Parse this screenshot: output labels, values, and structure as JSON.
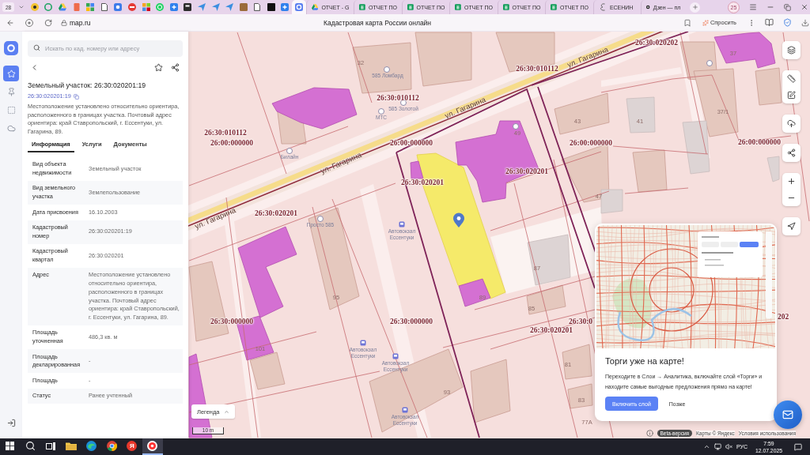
{
  "browser": {
    "tab_count": "28",
    "pinned_tabs": [
      {
        "selected": false
      },
      {
        "selected": false
      },
      {
        "selected": false
      },
      {
        "selected": false
      },
      {
        "selected": false
      },
      {
        "selected": false
      },
      {
        "selected": false
      },
      {
        "selected": false
      },
      {
        "selected": false
      },
      {
        "selected": false
      },
      {
        "selected": false
      },
      {
        "selected": false
      },
      {
        "selected": false
      },
      {
        "selected": false
      },
      {
        "selected": false
      },
      {
        "selected": false
      },
      {
        "selected": false
      },
      {
        "selected": false
      },
      {
        "selected": false
      },
      {
        "selected": true
      }
    ],
    "tabs": [
      {
        "kind": "drive",
        "title": "ОТЧЕТ - G",
        "selected": false
      },
      {
        "kind": "sheet",
        "title": "ОТЧЕТ ПО",
        "selected": false
      },
      {
        "kind": "sheet",
        "title": "ОТЧЕТ ПО",
        "selected": false
      },
      {
        "kind": "sheet",
        "title": "ОТЧЕТ ПО",
        "selected": false
      },
      {
        "kind": "sheet",
        "title": "ОТЧЕТ ПО",
        "selected": false
      },
      {
        "kind": "sheet",
        "title": "ОТЧЕТ ПО",
        "selected": false
      },
      {
        "kind": "letter",
        "title": "ЕСЕНИН",
        "selected": false
      },
      {
        "kind": "dzen",
        "title": "Дзен — пл",
        "selected": false
      }
    ],
    "profile": "25",
    "url": "map.ru",
    "page_title": "Кадастровая карта России онлайн",
    "ask_button": "Спросить"
  },
  "rail": [
    {
      "selected": true
    },
    {
      "selected": false
    },
    {
      "selected": false
    },
    {
      "selected": false
    }
  ],
  "panel": {
    "search": {
      "placeholder": "Искать по кад. номеру или адресу"
    },
    "title": "Земельный участок: 26:30:020201:19",
    "number_link": "26:30:020201:19",
    "description": "Местоположение установлено относительно ориентира, расположенного в границах участка. Почтовый адрес ориентира: край Ставропольский, г. Ессентуки, ул. Гагарина, 89.",
    "tabs": [
      {
        "label": "Информация",
        "selected": true
      },
      {
        "label": "Услуги",
        "selected": false
      },
      {
        "label": "Документы",
        "selected": false
      }
    ],
    "properties": [
      {
        "label": "Вид объекта недвижимости",
        "value": "Земельный участок"
      },
      {
        "label": "Вид земельного участка",
        "value": "Землепользование"
      },
      {
        "label": "Дата присвоения",
        "value": "16.10.2003"
      },
      {
        "label": "Кадастровый номер",
        "value": "26:30:020201:19"
      },
      {
        "label": "Кадастровый квартал",
        "value": "26:30:020201"
      },
      {
        "label": "Адрес",
        "value": "Местоположение установлено относительно ориентира, расположенного в границах участка. Почтовый адрес ориентира: край Ставропольский, г. Ессентуки, ул. Гагарина, 89."
      },
      {
        "label": "Площадь уточненная",
        "value": "486,3 кв. м"
      },
      {
        "label": "Площадь декларированная",
        "value": "-"
      },
      {
        "label": "Площадь",
        "value": "-"
      },
      {
        "label": "Статус",
        "value": "Ранее учтенный"
      }
    ]
  },
  "map": {
    "labels": [
      {
        "kind": "cadastral",
        "text": "26:30:020202"
      },
      {
        "kind": "street",
        "text": "ул. Гагарина"
      },
      {
        "kind": "house",
        "text": "37"
      },
      {
        "kind": "house",
        "text": "32"
      },
      {
        "kind": "cadastral",
        "text": "26:30:010112"
      },
      {
        "kind": "place",
        "text": "585 Ломбард"
      },
      {
        "kind": "cadastral",
        "text": "26:30:010112"
      },
      {
        "kind": "place",
        "text": "585 Золотой"
      },
      {
        "kind": "street",
        "text": "ул. Гагарина"
      },
      {
        "kind": "house",
        "text": "37/1"
      },
      {
        "kind": "place",
        "text": "МТС"
      },
      {
        "kind": "house",
        "text": "43"
      },
      {
        "kind": "house",
        "text": "41"
      },
      {
        "kind": "cadastral",
        "text": "26:30:010112"
      },
      {
        "kind": "house",
        "text": "49"
      },
      {
        "kind": "cadastral",
        "text": "26:00:000000"
      },
      {
        "kind": "cadastral",
        "text": "26:00:000000"
      },
      {
        "kind": "cadastral",
        "text": "26:00:000000"
      },
      {
        "kind": "cadastral",
        "text": "26:00:000000"
      },
      {
        "kind": "place",
        "text": "Билайн"
      },
      {
        "kind": "street",
        "text": "ул. Гагарина"
      },
      {
        "kind": "cadastral",
        "text": "26:30:020201"
      },
      {
        "kind": "cadastral",
        "text": "26:30:020201"
      },
      {
        "kind": "house",
        "text": "47"
      },
      {
        "kind": "cadastral",
        "text": "26:30:020201"
      },
      {
        "kind": "street",
        "text": "ул. Гагарина"
      },
      {
        "kind": "place",
        "text": "Просто 585"
      },
      {
        "kind": "place",
        "text": "Автовокзал Ессентуки"
      },
      {
        "kind": "house",
        "text": "87"
      },
      {
        "kind": "house",
        "text": "95"
      },
      {
        "kind": "house",
        "text": "89"
      },
      {
        "kind": "house",
        "text": "85"
      },
      {
        "kind": "cadastral",
        "text": "26:30:000000"
      },
      {
        "kind": "cadastral",
        "text": "26:30:000000"
      },
      {
        "kind": "cadastral",
        "text": "26:30:0"
      },
      {
        "kind": "cadastral",
        "text": "202"
      },
      {
        "kind": "cadastral",
        "text": "26:30:020201"
      },
      {
        "kind": "house",
        "text": "101"
      },
      {
        "kind": "place",
        "text": "Автовокзал Ессентуки"
      },
      {
        "kind": "house",
        "text": "81"
      },
      {
        "kind": "place",
        "text": "Автовокзал Ессентуки"
      },
      {
        "kind": "house",
        "text": "93"
      },
      {
        "kind": "house",
        "text": "83"
      },
      {
        "kind": "place",
        "text": "Автовокзал Ессентуки"
      },
      {
        "kind": "house",
        "text": "77А"
      }
    ]
  },
  "legend_button": "Легенда",
  "scale": "10 m",
  "attribution": {
    "beta": "Beta-версия",
    "copyright": "Карты © Яндекс",
    "terms": "Условия использования"
  },
  "promo": {
    "title": "Торги уже на карте!",
    "text": "Переходите в Слои → Аналитика, включайте слой «Торги» и находите самые выгодные предложения прямо на карте!",
    "primary": "Включить слой",
    "secondary": "Позже"
  },
  "taskbar": {
    "apps": [
      {
        "kind": "start",
        "selected": false
      },
      {
        "kind": "search",
        "selected": false
      },
      {
        "kind": "taskview",
        "selected": false
      },
      {
        "kind": "explorer",
        "selected": false
      },
      {
        "kind": "edge",
        "selected": false
      },
      {
        "kind": "chrome",
        "selected": false
      },
      {
        "kind": "yandex",
        "glyph": "Я",
        "selected": false
      },
      {
        "kind": "browser",
        "selected": true
      }
    ],
    "language": "РУС",
    "time": "7:59",
    "date": "12.07.2025"
  }
}
